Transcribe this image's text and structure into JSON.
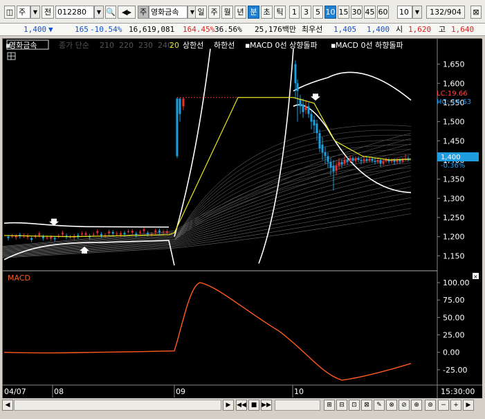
{
  "toolbar": {
    "market": "주",
    "all": "전",
    "code": "012280",
    "stock_tag": "주",
    "stock_name": "영화금속",
    "periods": [
      "일",
      "주",
      "월",
      "년",
      "분",
      "초",
      "틱"
    ],
    "selected_period": "분",
    "intervals": [
      "1",
      "3",
      "5",
      "10",
      "15",
      "30",
      "45",
      "60"
    ],
    "selected_interval": "10",
    "count": "10",
    "range": "132/904"
  },
  "quote": {
    "price": "1,400",
    "change": "165",
    "change_pct": "-10.54%",
    "volume": "16,619,081",
    "volume_ratio": "164.45%",
    "turnover": "36.56%",
    "amount": "25,176백만",
    "best_bid_label": "최우선",
    "best_ask": "1,405",
    "best_bid": "1,400",
    "open_label": "시",
    "open": "1,620",
    "high_label": "고",
    "high": "1,640"
  },
  "legend": {
    "name": "영화금속",
    "ma_label": "종가 단순",
    "ma_periods": "210  220  230  240",
    "ma20": "20",
    "upper": "상한선",
    "lower": "하한선",
    "macd_up": "MACD 0선 상향돌파",
    "macd_down": "MACD 0선 하향돌파"
  },
  "price_axis": {
    "ticks": [
      "1,650",
      "1,600",
      "1,550",
      "1,500",
      "1,450",
      "1,400",
      "1,350",
      "1,300",
      "1,250",
      "1,200",
      "1,150"
    ],
    "lc": "LC:19.66",
    "hc": "HC:-14.63",
    "current": "1,400",
    "current_pct": "-0.36%"
  },
  "macd": {
    "title": "MACD",
    "ticks": [
      "100.00",
      "75.00",
      "50.00",
      "25.00",
      "0.00",
      "-25.00"
    ]
  },
  "time_axis": {
    "labels": [
      "04/07",
      "08",
      "09",
      "10"
    ],
    "clock": "15:30:00"
  },
  "chart_data": {
    "type": "line",
    "price_range": [
      1120,
      1680
    ],
    "macd_range": [
      -45,
      110
    ],
    "colors": {
      "up": "#e83030",
      "down": "#18a0e0",
      "ma20": "#e8e820",
      "band": "#ffffff",
      "macd": "#ff5a1e"
    }
  }
}
